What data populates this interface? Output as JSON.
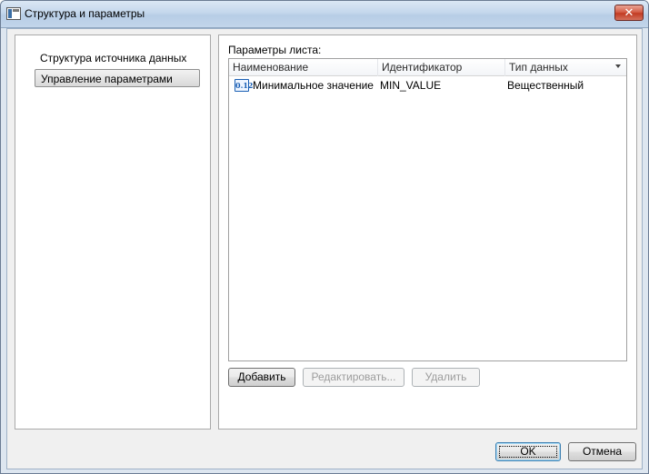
{
  "window": {
    "title": "Структура и параметры",
    "close_glyph": "✕"
  },
  "nav": {
    "items": [
      {
        "label": "Структура источника данных",
        "active": false
      },
      {
        "label": "Управление параметрами",
        "active": true
      }
    ]
  },
  "params": {
    "label": "Параметры листа:",
    "columns": [
      "Наименование",
      "Идентификатор",
      "Тип данных"
    ],
    "rows": [
      {
        "icon": "0.12",
        "name": "Минимальное значение",
        "id": "MIN_VALUE",
        "type": "Вещественный"
      }
    ],
    "add_label": "Добавить",
    "edit_label": "Редактировать...",
    "delete_label": "Удалить"
  },
  "footer": {
    "ok_label": "OK",
    "cancel_label": "Отмена"
  },
  "colors": {
    "accent": "#3c7fb1",
    "close_red": "#c23b22",
    "icon_blue": "#1a5fb4"
  }
}
